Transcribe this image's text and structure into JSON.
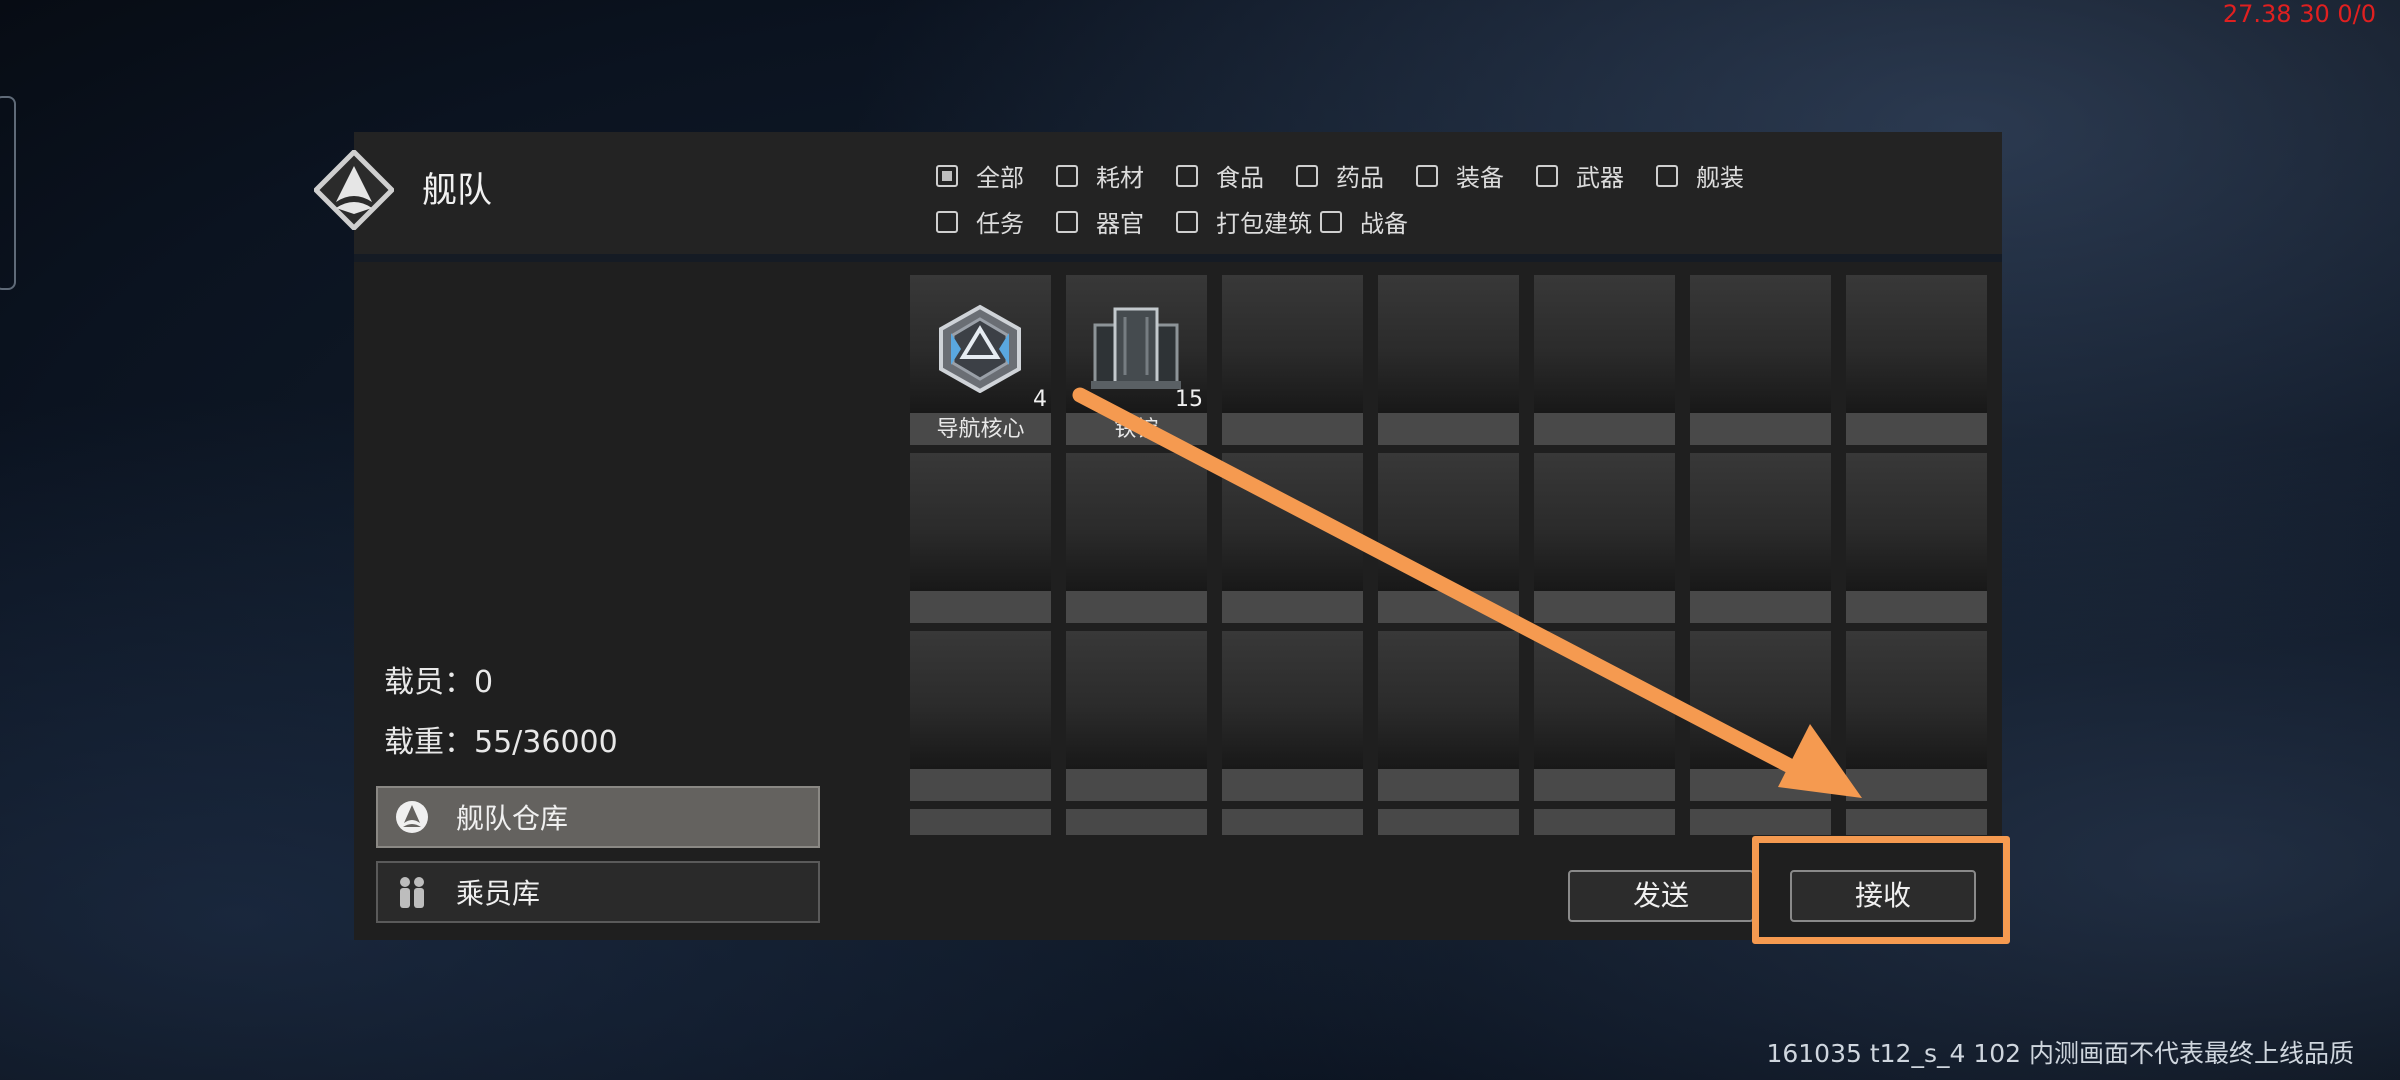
{
  "fps_overlay": "27.38 30 0/0",
  "watermark": "161035 t12_s_4 102  内测画面不代表最终上线品质",
  "panel": {
    "title": "舰队"
  },
  "filters": [
    {
      "label": "全部",
      "checked": true
    },
    {
      "label": "耗材",
      "checked": false
    },
    {
      "label": "食品",
      "checked": false
    },
    {
      "label": "药品",
      "checked": false
    },
    {
      "label": "装备",
      "checked": false
    },
    {
      "label": "武器",
      "checked": false
    },
    {
      "label": "舰装",
      "checked": false
    },
    {
      "label": "任务",
      "checked": false
    },
    {
      "label": "器官",
      "checked": false
    },
    {
      "label": "打包建筑",
      "checked": false
    },
    {
      "label": "战备",
      "checked": false
    }
  ],
  "items": [
    {
      "name": "导航核心",
      "count": "4",
      "icon": "navigation-core-icon"
    },
    {
      "name": "铁锭",
      "count": "15",
      "icon": "iron-ingot-icon"
    }
  ],
  "stats": {
    "crew": "载员：0",
    "load": "载重：55/36000"
  },
  "side_buttons": {
    "warehouse": "舰队仓库",
    "crew": "乘员库"
  },
  "actions": {
    "send": "发送",
    "receive": "接收"
  },
  "annotation": {
    "color": "#f59a50"
  }
}
